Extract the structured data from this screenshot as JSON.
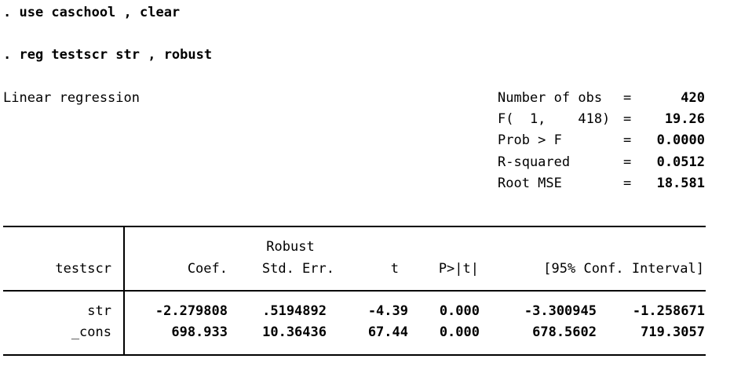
{
  "commands": [
    ". use caschool , clear",
    ". reg testscr str , robust"
  ],
  "model_title": "Linear regression",
  "stats": {
    "labels": [
      "Number of obs",
      "F(  1,    418)",
      "Prob > F",
      "R-squared",
      "Root MSE"
    ],
    "values": [
      "420",
      "19.26",
      "0.0000",
      "0.0512",
      "18.581"
    ],
    "eq": "="
  },
  "table": {
    "depvar": "testscr",
    "header_robust": "Robust",
    "headers": [
      "Coef.",
      "Std. Err.",
      "t",
      "P>|t|",
      "[95% Conf. Interval]"
    ],
    "rows": [
      {
        "name": "str",
        "coef": "-2.279808",
        "se": ".5194892",
        "t": "-4.39",
        "p": "0.000",
        "lo": "-3.300945",
        "hi": "-1.258671"
      },
      {
        "name": "_cons",
        "coef": "698.933",
        "se": "10.36436",
        "t": "67.44",
        "p": "0.000",
        "lo": "678.5602",
        "hi": "719.3057"
      }
    ]
  }
}
